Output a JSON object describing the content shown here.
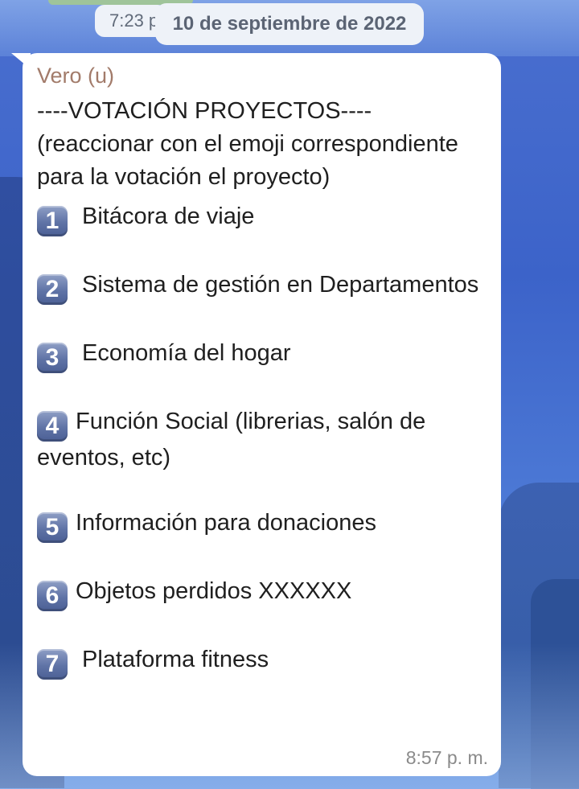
{
  "header": {
    "time_partial": "7:23 p",
    "date_label": "10 de septiembre de 2022"
  },
  "message": {
    "sender": "Vero (u)",
    "title": "----VOTACIÓN PROYECTOS----",
    "instruction": "(reaccionar con el emoji correspondiente para la votación el proyecto)",
    "items": [
      {
        "number": "1",
        "text": "Bitácora de viaje"
      },
      {
        "number": "2",
        "text": "Sistema de gestión en Departamentos"
      },
      {
        "number": "3",
        "text": "Economía del hogar"
      },
      {
        "number": "4",
        "text": "Función Social (librerias, salón de eventos, etc)"
      },
      {
        "number": "5",
        "text": "Información para donaciones"
      },
      {
        "number": "6",
        "text": "Objetos perdidos XXXXXX"
      },
      {
        "number": "7",
        "text": "Plataforma fitness"
      }
    ],
    "time": "8:57 p. m."
  },
  "colors": {
    "sender": "#a27b6a",
    "bubble": "#ffffff",
    "keycap": "#5f73a6"
  }
}
